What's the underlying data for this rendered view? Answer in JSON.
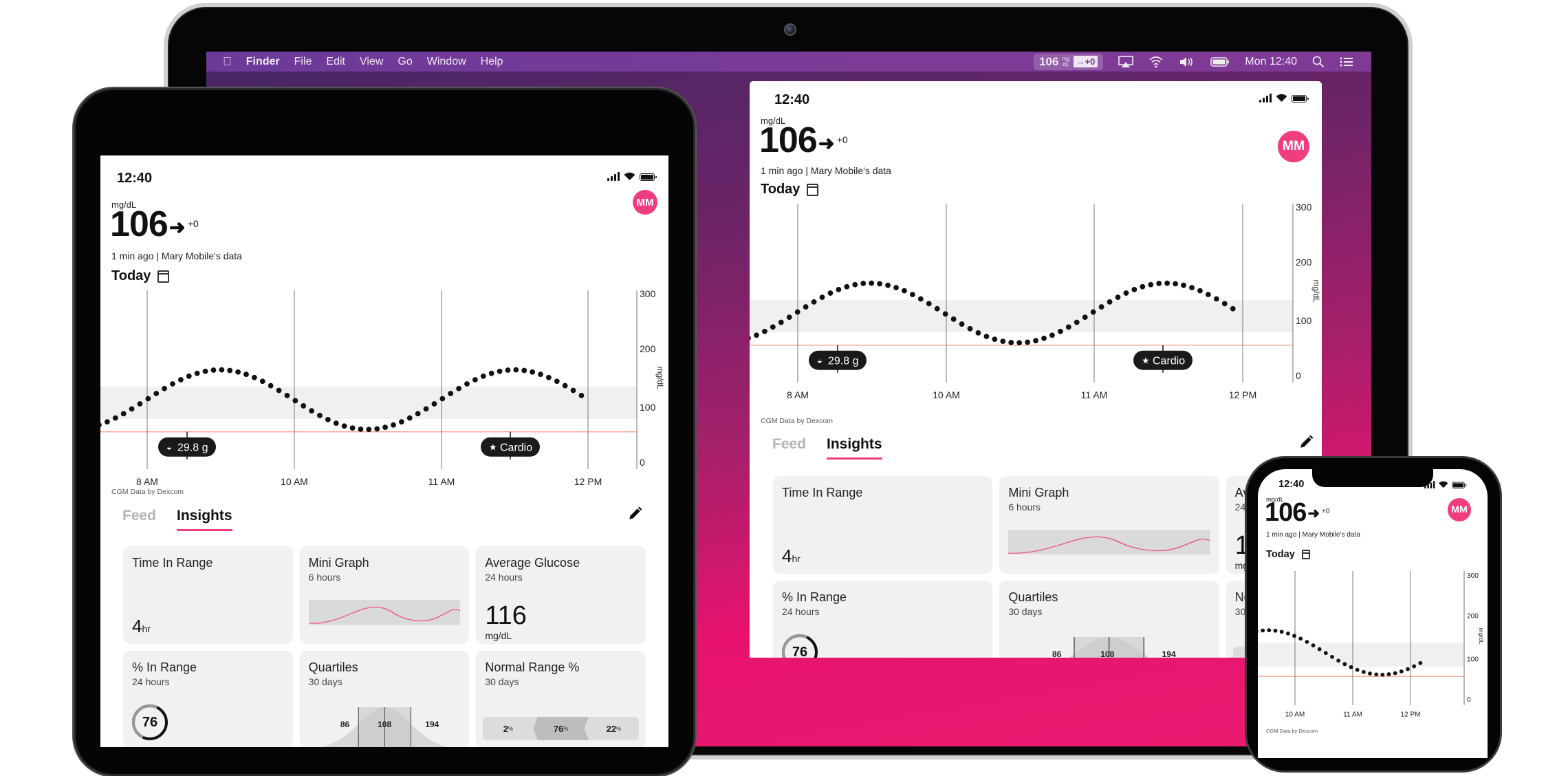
{
  "menubar": {
    "apple_icon": "apple-logo-icon",
    "app_name": "Finder",
    "menus": [
      "File",
      "Edit",
      "View",
      "Go",
      "Window",
      "Help"
    ],
    "glucose_widget": {
      "value": "106",
      "unit_top": "mg",
      "unit_bottom": "dL",
      "trend": "→+0"
    },
    "status_icons": [
      "airplay-icon",
      "wifi-icon",
      "volume-icon",
      "battery-icon"
    ],
    "clock": "Mon 12:40",
    "right_icons": [
      "spotlight-search-icon",
      "notification-center-icon"
    ]
  },
  "app": {
    "status_time": "12:40",
    "unit": "mg/dL",
    "glucose_value": "106",
    "trend_arrow": "➜",
    "trend_delta": "+0",
    "last_update": "1 min ago | Mary Mobile's data",
    "avatar_initials": "MM",
    "date_label": "Today",
    "credit": "CGM Data by Dexcom",
    "tabs": [
      {
        "label": "Feed",
        "active": false
      },
      {
        "label": "Insights",
        "active": true
      }
    ],
    "cards": [
      {
        "title": "Time In Range",
        "subtitle": "",
        "value": "4",
        "unit": "hr"
      },
      {
        "title": "Mini Graph",
        "subtitle": "6 hours"
      },
      {
        "title": "Average Glucose",
        "subtitle": "24 hours",
        "value": "116",
        "unit": "mg/dL"
      },
      {
        "title": "% In Range",
        "subtitle": "24 hours",
        "value": "76"
      },
      {
        "title": "Quartiles",
        "subtitle": "30 days",
        "q1": "86",
        "median": "108",
        "q3": "194"
      },
      {
        "title": "Normal Range %",
        "subtitle": "30 days",
        "low": "2",
        "in": "76",
        "high": "22",
        "pct": "%"
      }
    ],
    "colors": {
      "accent": "#ef3d7f",
      "low_line": "#f5a08a",
      "range_band": "#f0f0f0",
      "card": "#f1f1f1"
    }
  },
  "chart_data": {
    "type": "scatter",
    "title": "Today",
    "ylabel": "mg/dL",
    "ylim": [
      0,
      300
    ],
    "yticks": [
      "300",
      "200",
      "100",
      "0"
    ],
    "xticks": [
      "8 AM",
      "10 AM",
      "11 AM",
      "12 PM"
    ],
    "phone_xticks": [
      "10 AM",
      "11 AM",
      "12 PM"
    ],
    "target_range": [
      80,
      135
    ],
    "low_threshold": 58,
    "series": [
      {
        "name": "glucose",
        "description": "sinusoidal glucose readings, min ≈ 62, max ≈ 165, last ≈ 112"
      }
    ],
    "events": [
      {
        "label": "29.8 g",
        "kind": "carbs",
        "icon": "bowl-icon"
      },
      {
        "label": "Cardio",
        "kind": "exercise",
        "icon": "running-icon"
      }
    ]
  }
}
